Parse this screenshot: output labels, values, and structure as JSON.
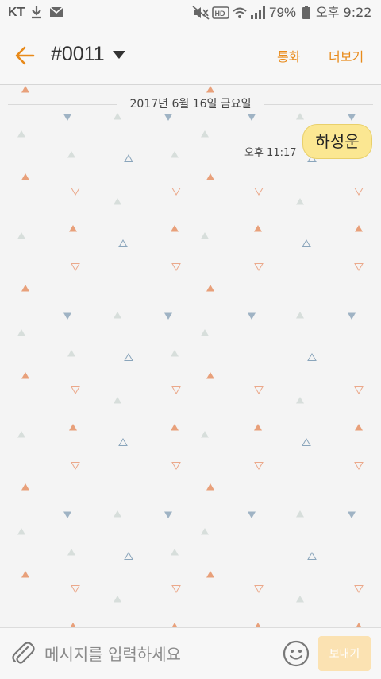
{
  "status_bar": {
    "carrier": "KT",
    "battery_percent": "79%",
    "time": "오후 9:22",
    "icons": [
      "download-icon",
      "mail-icon",
      "mute-icon",
      "hd-icon",
      "wifi-icon",
      "signal-icon",
      "battery-icon"
    ]
  },
  "header": {
    "back_icon": "back-arrow-icon",
    "title": "#0011",
    "call_label": "통화",
    "more_label": "더보기",
    "accent_color": "#e88a1a"
  },
  "chat": {
    "date_divider": "2017년 6월 16일 금요일",
    "messages": [
      {
        "text": "하성운",
        "time": "오후 11:17",
        "bubble_color": "#fbe792"
      }
    ]
  },
  "input_bar": {
    "attach_icon": "paperclip-icon",
    "placeholder": "메시지를 입력하세요",
    "value": "",
    "emoji_icon": "emoji-icon",
    "send_label": "보내기",
    "send_color": "#fbe2b2"
  }
}
